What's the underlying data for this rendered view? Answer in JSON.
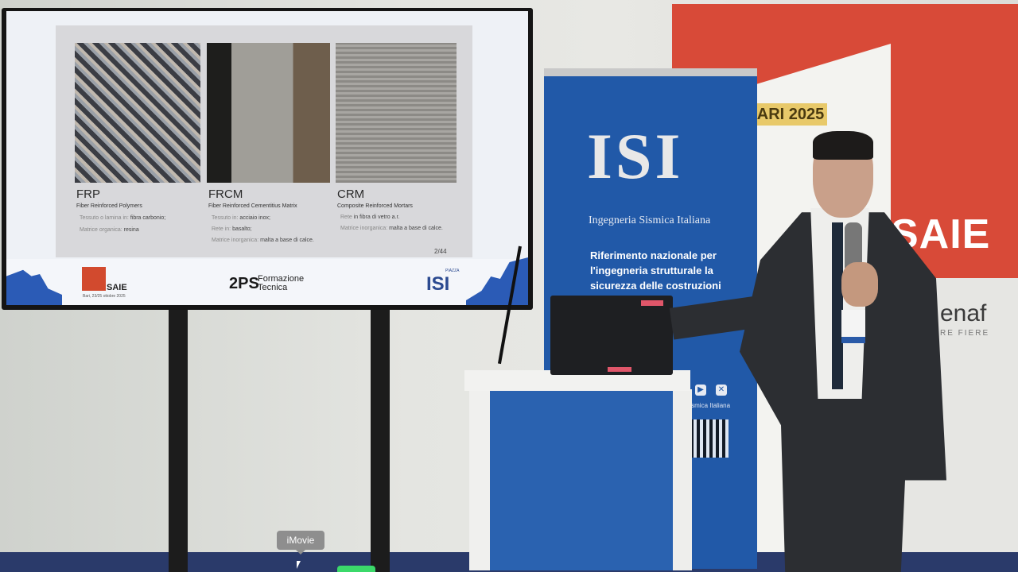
{
  "slide": {
    "columns": [
      {
        "title": "FRP",
        "subtitle": "Fiber Reinforced Polymers",
        "lines": [
          {
            "soft": "Tessuto o lamina in:",
            "strong": "fibra carbonio;"
          },
          {
            "soft": "Matrice organica:",
            "strong": "resina"
          }
        ]
      },
      {
        "title": "FRCM",
        "subtitle": "Fiber Reinforced Cementitius Matrix",
        "lines": [
          {
            "soft": "Tessuto in:",
            "strong": "acciaio inox;"
          },
          {
            "soft": "Rete in:",
            "strong": "basalto;"
          },
          {
            "soft": "Matrice inorganica:",
            "strong": "malta a base di calce."
          }
        ]
      },
      {
        "title": "CRM",
        "subtitle": "Composite Reinforced Mortars",
        "lines": [
          {
            "soft": "Rete",
            "strong": "in fibra di vetro a.r."
          },
          {
            "soft": "Matrice inorganica:",
            "strong": "malta a base di calce."
          }
        ]
      }
    ],
    "page": "2/44",
    "footer": {
      "saie": "SAIE",
      "saie_date": "Bari, 23/25 ottobre 2025",
      "twops": "2PS",
      "formazione_1": "Formazione",
      "formazione_2": "Tecnica",
      "piazza": "PIAZZA",
      "isi": "ISI"
    }
  },
  "backdrop": {
    "date_banner": "ARI 2025",
    "saie": "SAIE",
    "enaf": "enaf",
    "fiere": "RE FIERE"
  },
  "banner": {
    "logo": "ISI",
    "full_name": "Ingegneria Sismica Italiana",
    "headline": "Riferimento nazionale per l'ingegneria strutturale la sicurezza delle costruzioni antisismiche",
    "footer": "Ingegneria Sismica Italiana"
  },
  "tooltip": "iMovie",
  "colors": {
    "brand_blue": "#2159a8",
    "saie_red": "#d84a38"
  }
}
